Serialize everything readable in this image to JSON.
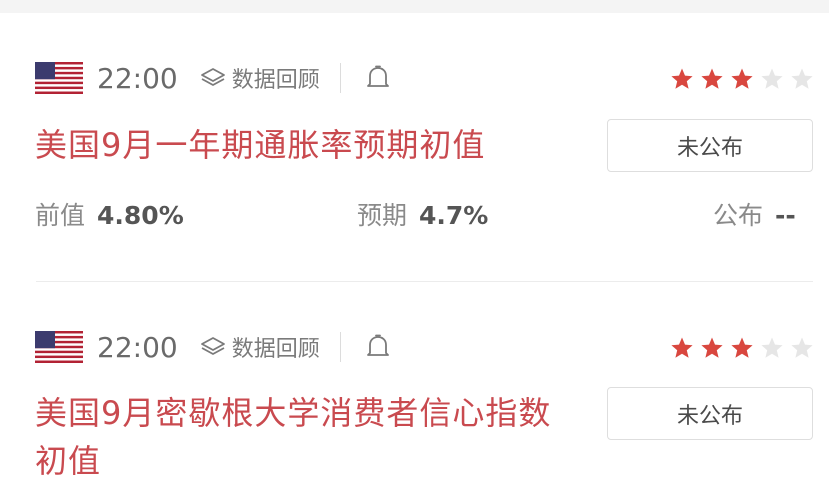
{
  "events": [
    {
      "country_flag": "us-flag-icon",
      "time": "22:00",
      "review_label": "数据回顾",
      "stars_filled": 3,
      "stars_total": 5,
      "title": "美国9月一年期通胀率预期初值",
      "status": "未公布",
      "previous_label": "前值",
      "previous_value": "4.80%",
      "forecast_label": "预期",
      "forecast_value": "4.7%",
      "actual_label": "公布",
      "actual_value": "--"
    },
    {
      "country_flag": "us-flag-icon",
      "time": "22:00",
      "review_label": "数据回顾",
      "stars_filled": 3,
      "stars_total": 5,
      "title_line1": "美国9月密歇根大学消费者信心指数",
      "title_line2": "初值",
      "status": "未公布"
    }
  ],
  "colors": {
    "accent": "#c94a4f",
    "star_filled": "#d9473f",
    "star_empty": "#e6e6e6"
  }
}
